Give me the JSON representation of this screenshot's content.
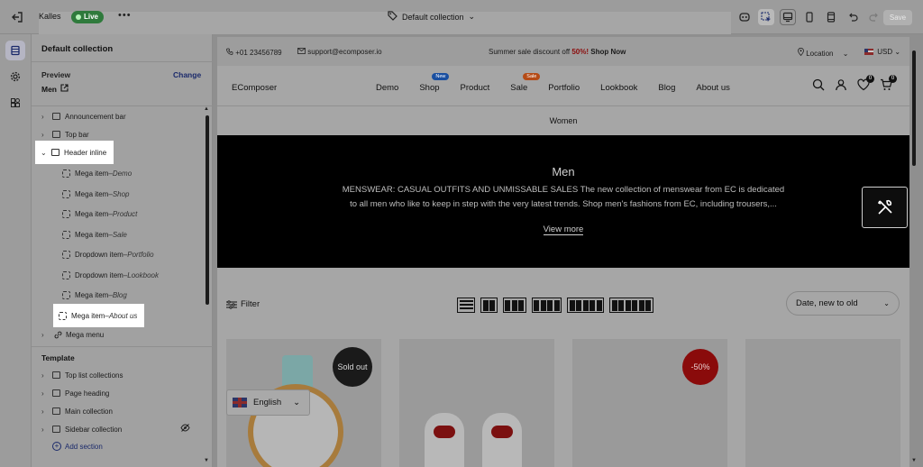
{
  "topbar": {
    "store_name": "Kalles",
    "status": "Live",
    "more_label": "•••",
    "page_selector": "Default collection",
    "save_label": "Save"
  },
  "sidebar": {
    "title": "Default collection",
    "preview_label": "Preview",
    "change_label": "Change",
    "preview_value": "Men",
    "sections": [
      {
        "label": "Announcement bar",
        "expanded": false
      },
      {
        "label": "Top bar",
        "expanded": false
      },
      {
        "label": "Header inline",
        "expanded": true,
        "highlighted": true
      }
    ],
    "header_children": [
      {
        "type": "Mega item",
        "name": "Demo"
      },
      {
        "type": "Mega item",
        "name": "Shop"
      },
      {
        "type": "Mega item",
        "name": "Product"
      },
      {
        "type": "Mega item",
        "name": "Sale"
      },
      {
        "type": "Dropdown item",
        "name": "Portfolio"
      },
      {
        "type": "Dropdown item",
        "name": "Lookbook"
      },
      {
        "type": "Mega item",
        "name": "Blog"
      },
      {
        "type": "Mega item",
        "name": "About us",
        "highlighted": true
      }
    ],
    "mega_menu": "Mega menu",
    "template_label": "Template",
    "template_sections": [
      {
        "label": "Top list collections"
      },
      {
        "label": "Page heading"
      },
      {
        "label": "Main collection"
      },
      {
        "label": "Sidebar collection",
        "hidden": true
      }
    ],
    "add_section_label": "Add section",
    "separator": " – "
  },
  "store": {
    "announcement": {
      "phone": "+01 23456789",
      "email": "support@ecomposer.io",
      "promo_prefix": "Summer sale discount off ",
      "promo_sale": "50%!",
      "promo_cta": " Shop Now",
      "location": "Location",
      "currency": "USD"
    },
    "header": {
      "logo": "EComposer",
      "nav": [
        {
          "label": "Demo"
        },
        {
          "label": "Shop",
          "badge": "New"
        },
        {
          "label": "Product"
        },
        {
          "label": "Sale",
          "badge": "Sale"
        },
        {
          "label": "Portfolio"
        },
        {
          "label": "Lookbook"
        },
        {
          "label": "Blog"
        },
        {
          "label": "About us"
        }
      ],
      "wishlist_count": "0",
      "cart_count": "0"
    },
    "breadcrumb": "Women",
    "hero": {
      "title": "Men",
      "description": "MENSWEAR: CASUAL OUTFITS AND UNMISSABLE SALES The new collection of menswear from EC is dedicated to all men who like to keep in step with the very latest trends. Shop men's fashions from EC, including trousers,...",
      "view_more": "View more"
    },
    "filter_label": "Filter",
    "sort_value": "Date, new to old",
    "products": [
      {
        "badge": "Sold out"
      },
      {
        "badge": ""
      },
      {
        "badge": "-50%"
      },
      {
        "badge": ""
      }
    ],
    "language": "English"
  },
  "colors": {
    "live_badge": "#2f7a3c",
    "link_blue": "#1b2a6b",
    "sale_red": "#8a0b0b",
    "hero_bg": "#000000"
  }
}
